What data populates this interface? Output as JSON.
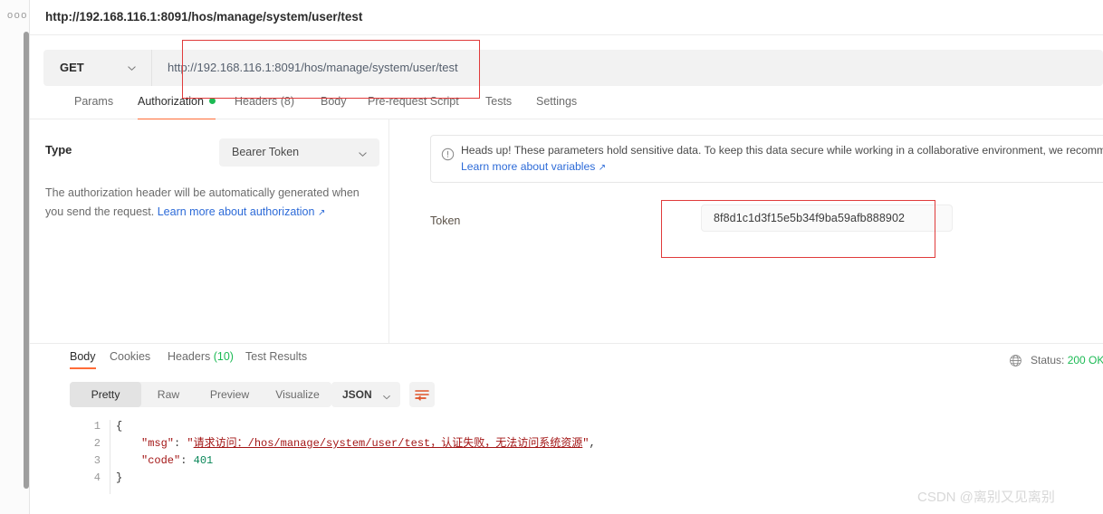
{
  "rail": {
    "menu_icon": "ellipsis-icon"
  },
  "request": {
    "title": "http://192.168.116.1:8091/hos/manage/system/user/test",
    "method": "GET",
    "url": "http://192.168.116.1:8091/hos/manage/system/user/test",
    "tabs": [
      {
        "label": "Params",
        "active": false,
        "dot": false
      },
      {
        "label": "Authorization",
        "active": true,
        "dot": true
      },
      {
        "label": "Headers (8)",
        "active": false,
        "dot": false
      },
      {
        "label": "Body",
        "active": false,
        "dot": false
      },
      {
        "label": "Pre-request Script",
        "active": false,
        "dot": false
      },
      {
        "label": "Tests",
        "active": false,
        "dot": false
      },
      {
        "label": "Settings",
        "active": false,
        "dot": false
      }
    ]
  },
  "authorization": {
    "type_label": "Type",
    "type_value": "Bearer Token",
    "description": "The authorization header will be automatically generated when you send the request.",
    "description_link": "Learn more about authorization",
    "notice_text": "Heads up! These parameters hold sensitive data. To keep this data secure while working in a collaborative environment, we recomm",
    "notice_link": "Learn more about variables",
    "token_label": "Token",
    "token_value": "8f8d1c1d3f15e5b34f9ba59afb888902"
  },
  "response": {
    "tabs": [
      {
        "label": "Body",
        "count": "",
        "active": true
      },
      {
        "label": "Cookies",
        "count": "",
        "active": false
      },
      {
        "label": "Headers",
        "count": "(10)",
        "active": false
      },
      {
        "label": "Test Results",
        "count": "",
        "active": false
      }
    ],
    "status_prefix": "Status:",
    "status_value": "200 OK",
    "view_modes": [
      {
        "label": "Pretty",
        "active": true
      },
      {
        "label": "Raw",
        "active": false
      },
      {
        "label": "Preview",
        "active": false
      },
      {
        "label": "Visualize",
        "active": false
      }
    ],
    "format": "JSON",
    "wrap_icon": "wrap-lines-icon",
    "globe_icon": "globe-icon",
    "body": {
      "line_numbers": [
        "1",
        "2",
        "3",
        "4"
      ],
      "lines": [
        {
          "open_brace": "{"
        },
        {
          "key": "\"msg\"",
          "colon": ": ",
          "quote_open": "\"",
          "link_text": "请求访问：/hos/manage/system/user/test，认证失败，无法访问系统资源",
          "quote_close": "\"",
          "comma": ","
        },
        {
          "key": "\"code\"",
          "colon": ": ",
          "number": "401"
        },
        {
          "close_brace": "}"
        }
      ]
    }
  },
  "watermark": "CSDN @离别又见离别",
  "colors": {
    "accent": "#ff6c37",
    "green": "#1cba54",
    "link": "#2d6bd8",
    "annotation_red": "#e03b3b"
  }
}
